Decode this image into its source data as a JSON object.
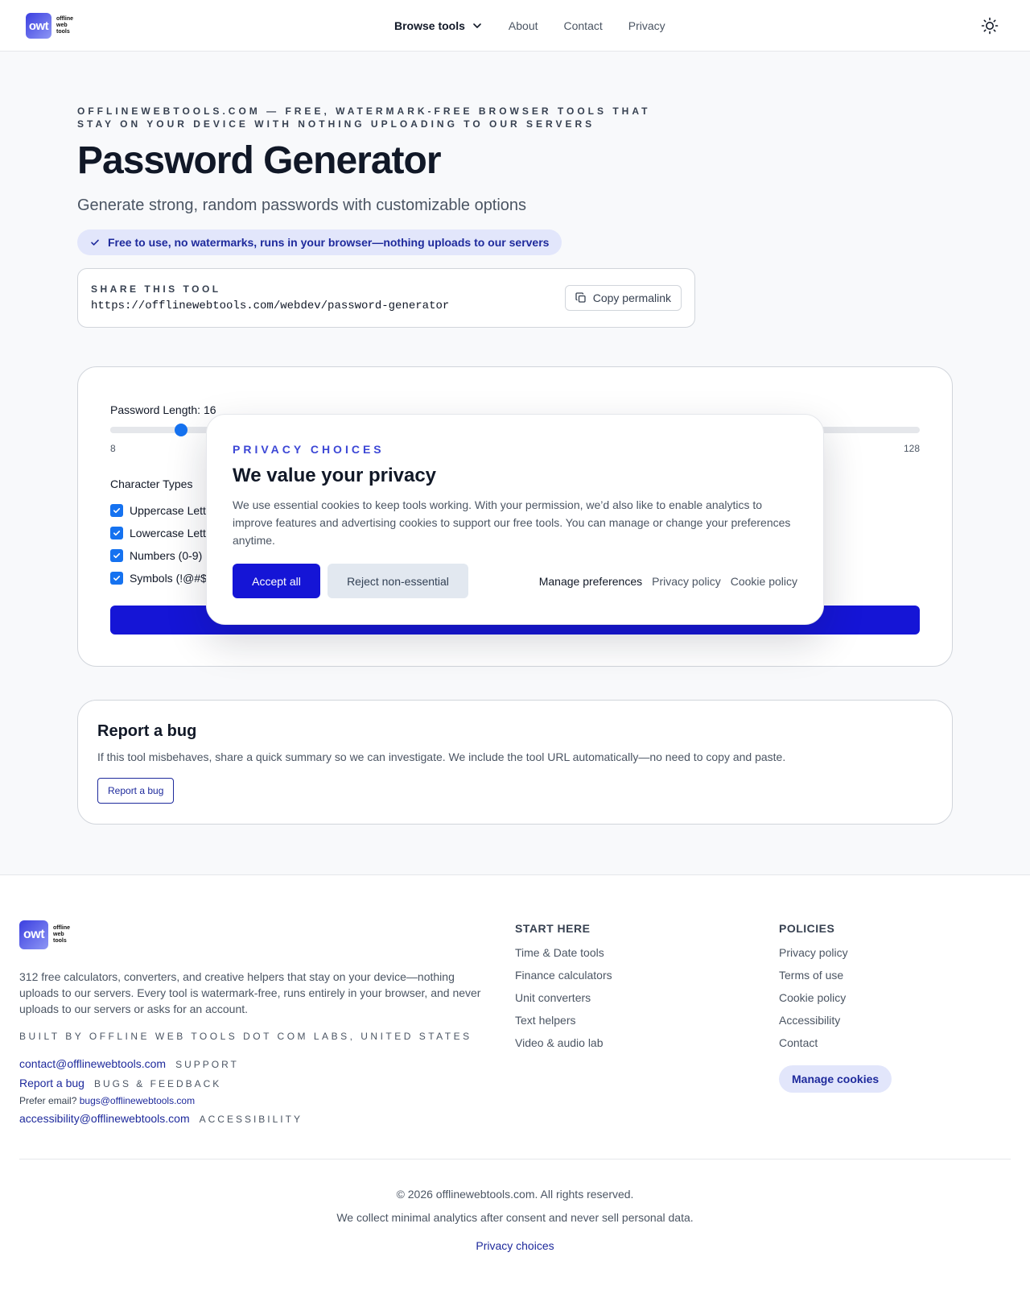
{
  "header": {
    "logo_mark": "owt",
    "logo_words": [
      "offline",
      "web",
      "tools"
    ],
    "nav": {
      "browse": "Browse tools",
      "about": "About",
      "contact": "Contact",
      "privacy": "Privacy"
    },
    "theme_icon": "sun-icon"
  },
  "hero": {
    "eyebrow": "OFFLINEWEBTOOLS.COM — FREE, WATERMARK-FREE BROWSER TOOLS THAT STAY ON YOUR DEVICE WITH NOTHING UPLOADING TO OUR SERVERS",
    "title": "Password Generator",
    "subtitle": "Generate strong, random passwords with customizable options",
    "badge": "Free to use, no watermarks, runs in your browser—nothing uploads to our servers"
  },
  "share": {
    "label": "SHARE THIS TOOL",
    "url": "https://offlinewebtools.com/webdev/password-generator",
    "copy_button": "Copy permalink"
  },
  "tool": {
    "length_label": "Password Length: 16",
    "length_value": 16,
    "length_min": 8,
    "length_max": 128,
    "min_label": "8",
    "max_label": "128",
    "char_types_title": "Character Types",
    "options": [
      {
        "label": "Uppercase Lett",
        "checked": true
      },
      {
        "label": "Lowercase Lett",
        "checked": true
      },
      {
        "label": "Numbers (0-9)",
        "checked": true
      },
      {
        "label": "Symbols (!@#$",
        "checked": true
      }
    ],
    "accent_color": "#1572f0",
    "generate_color": "#1515d6"
  },
  "bug": {
    "title": "Report a bug",
    "description": "If this tool misbehaves, share a quick summary so we can investigate. We include the tool URL automatically—no need to copy and paste.",
    "button": "Report a bug"
  },
  "consent": {
    "eyebrow": "PRIVACY CHOICES",
    "title": "We value your privacy",
    "body": "We use essential cookies to keep tools working. With your permission, we’d also like to enable analytics to improve features and advertising cookies to support our free tools. You can manage or change your preferences anytime.",
    "accept": "Accept all",
    "reject": "Reject non-essential",
    "manage": "Manage preferences",
    "privacy_policy": "Privacy policy",
    "cookie_policy": "Cookie policy"
  },
  "footer": {
    "about": "312 free calculators, converters, and creative helpers that stay on your device—nothing uploads to our servers. Every tool is watermark-free, runs entirely in your browser, and never uploads to our servers or asks for an account.",
    "built_by": "BUILT BY OFFLINE WEB TOOLS DOT COM LABS, UNITED STATES",
    "contact_email": "contact@offlinewebtools.com",
    "contact_tag": "SUPPORT",
    "report_link": "Report a bug",
    "report_tag": "BUGS & FEEDBACK",
    "prefer_email_label": "Prefer email?",
    "bugs_email": "bugs@offlinewebtools.com",
    "accessibility_email": "accessibility@offlinewebtools.com",
    "accessibility_tag": "ACCESSIBILITY",
    "start_here": {
      "title": "START HERE",
      "items": [
        "Time & Date tools",
        "Finance calculators",
        "Unit converters",
        "Text helpers",
        "Video & audio lab"
      ]
    },
    "policies": {
      "title": "POLICIES",
      "items": [
        "Privacy policy",
        "Terms of use",
        "Cookie policy",
        "Accessibility",
        "Contact"
      ],
      "manage_cookies": "Manage cookies"
    },
    "copyright": "© 2026 offlinewebtools.com. All rights reserved.",
    "analytics_note": "We collect minimal analytics after consent and never sell personal data.",
    "privacy_choices": "Privacy choices"
  }
}
